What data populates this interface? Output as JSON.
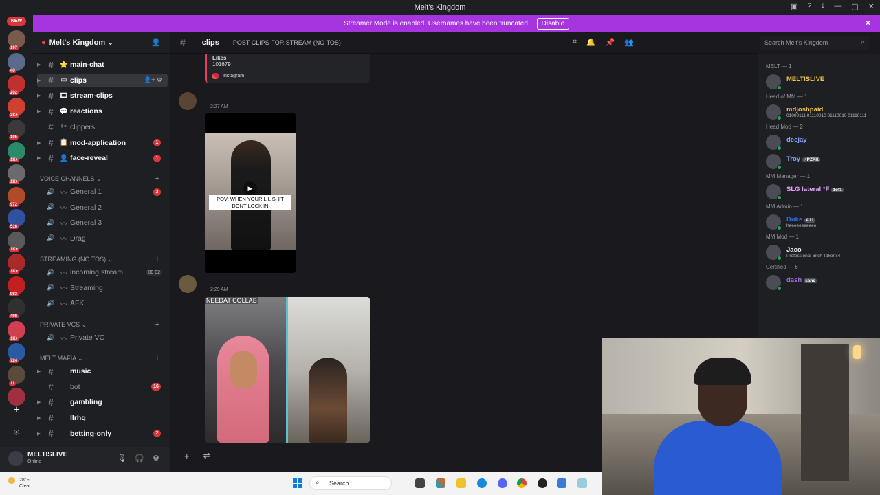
{
  "window": {
    "title": "Melt's Kingdom"
  },
  "banner": {
    "text": "Streamer Mode is enabled. Usernames have been truncated.",
    "button": "Disable",
    "close": "✕",
    "color": "#a635e0"
  },
  "servers": {
    "top_badge": "NEW",
    "items": [
      {
        "badge": "107",
        "color": "#7a5a4a"
      },
      {
        "badge": "40",
        "color": "#5a6a8a"
      },
      {
        "badge": "202",
        "color": "#c03030"
      },
      {
        "badge": "3K+",
        "color": "#d04030"
      },
      {
        "badge": "105",
        "color": "#3a3a3a"
      },
      {
        "badge": "1K+",
        "color": "#2a8a6a"
      },
      {
        "badge": "1K+",
        "color": "#6a6a6a"
      },
      {
        "badge": "972",
        "color": "#b04a2a"
      },
      {
        "badge": "516",
        "color": "#3050a0"
      },
      {
        "badge": "1K+",
        "color": "#5a5a5a"
      },
      {
        "badge": "1K+",
        "color": "#aa2a2a"
      },
      {
        "badge": "983",
        "color": "#c02020"
      },
      {
        "badge": "498",
        "color": "#303030"
      },
      {
        "badge": "1K+",
        "color": "#d04050"
      },
      {
        "badge": "724",
        "color": "#2a5aa0"
      },
      {
        "badge": "11",
        "color": "#5a4a3a"
      },
      {
        "badge": "",
        "color": "#a03040"
      }
    ],
    "add": "+",
    "discover": "⌾"
  },
  "sidebar": {
    "server_name": "Melt's Kingdom ⌄",
    "channels": [
      {
        "name": "main-chat",
        "emoji": "⭐",
        "bold": true
      },
      {
        "name": "clips",
        "emoji": "▭",
        "bold": true,
        "active": true,
        "tools": "👤+ ⚙"
      },
      {
        "name": "stream-clips",
        "emoji": "🎞",
        "bold": true
      },
      {
        "name": "reactions",
        "emoji": "💬",
        "bold": true
      },
      {
        "name": "clippers",
        "emoji": "✂",
        "bold": false
      },
      {
        "name": "mod-application",
        "emoji": "📋",
        "bold": true,
        "badge": "1"
      },
      {
        "name": "face-reveal",
        "emoji": "👤",
        "bold": true,
        "badge": "1"
      }
    ],
    "voice_cat": "VOICE CHANNELS ⌄",
    "voice": [
      {
        "name": "General 1",
        "badge": "3"
      },
      {
        "name": "General 2"
      },
      {
        "name": "General 3"
      },
      {
        "name": "Drag"
      }
    ],
    "streaming_cat": "STREAMING (NO TOS) ⌄",
    "streaming": [
      {
        "name": "incoming stream",
        "counter": "00 02"
      },
      {
        "name": "Streaming"
      },
      {
        "name": "AFK"
      }
    ],
    "private_cat": "PRIVATE VCS ⌄",
    "private": [
      {
        "name": "Private VC"
      }
    ],
    "mafia_cat": "MELT MAFIA ⌄",
    "mafia": [
      {
        "name": "music",
        "bold": true
      },
      {
        "name": "bot",
        "bold": false,
        "badge": "16"
      },
      {
        "name": "gambling",
        "bold": true
      },
      {
        "name": "llrhq",
        "bold": true
      },
      {
        "name": "betting-only",
        "bold": true,
        "badge": "2"
      }
    ],
    "plus": "+"
  },
  "user": {
    "name": "MELTISLIVE",
    "status": "Online"
  },
  "chat": {
    "channel": "clips",
    "topic": "POST CLIPS FOR STREAM (NO TOS)",
    "search_placeholder": "Search Melt's Kingdom",
    "embed_tail": {
      "label": "Likes",
      "value": "101679",
      "source": "Instagram"
    },
    "msg1": {
      "time": "2:27 AM",
      "caption": "POV: WHEN YOUR LIL SHIT DONT LOCK IN"
    },
    "msg2": {
      "time": "2:29 AM",
      "caption": "NEEDAT COLLAB"
    },
    "composer_plus": "+",
    "composer_gift": "⇌"
  },
  "members": {
    "groups": [
      {
        "header": "MELT — 1",
        "members": [
          {
            "name": "MELTISLIVE",
            "color": "#f0c14b",
            "sub": ""
          }
        ]
      },
      {
        "header": "Head of MM — 1",
        "members": [
          {
            "name": "mdjoshpaid",
            "color": "#f0c14b",
            "sub": "01000111 01110010 01110010 01110111"
          }
        ]
      },
      {
        "header": "Head Mod — 2",
        "members": [
          {
            "name": "deejay",
            "color": "#8aa4ff",
            "sub": ""
          },
          {
            "name": "Troy",
            "color": "#8aa4ff",
            "sub": "",
            "tag": "⚡PZPK"
          }
        ]
      },
      {
        "header": "MM Manager — 1",
        "members": [
          {
            "name": "SLG lateral °F",
            "color": "#e6a0ff",
            "sub": "",
            "tag": "1of1"
          }
        ]
      },
      {
        "header": "MM Admin — 1",
        "members": [
          {
            "name": "Duke",
            "color": "#2d6be0",
            "sub": "heeeeeeeeeee",
            "tag": "A11"
          }
        ]
      },
      {
        "header": "MM Mod — 1",
        "members": [
          {
            "name": "Jaco",
            "color": "#f2f3f5",
            "sub": "Professional Bitch Taker x4"
          }
        ]
      },
      {
        "header": "Certified — 6",
        "members": [
          {
            "name": "dash",
            "color": "#a06ad8",
            "sub": "",
            "tag": "sanc"
          }
        ]
      }
    ]
  },
  "taskbar": {
    "weather_temp": "28°F",
    "weather_desc": "Clear",
    "search": "Search"
  }
}
